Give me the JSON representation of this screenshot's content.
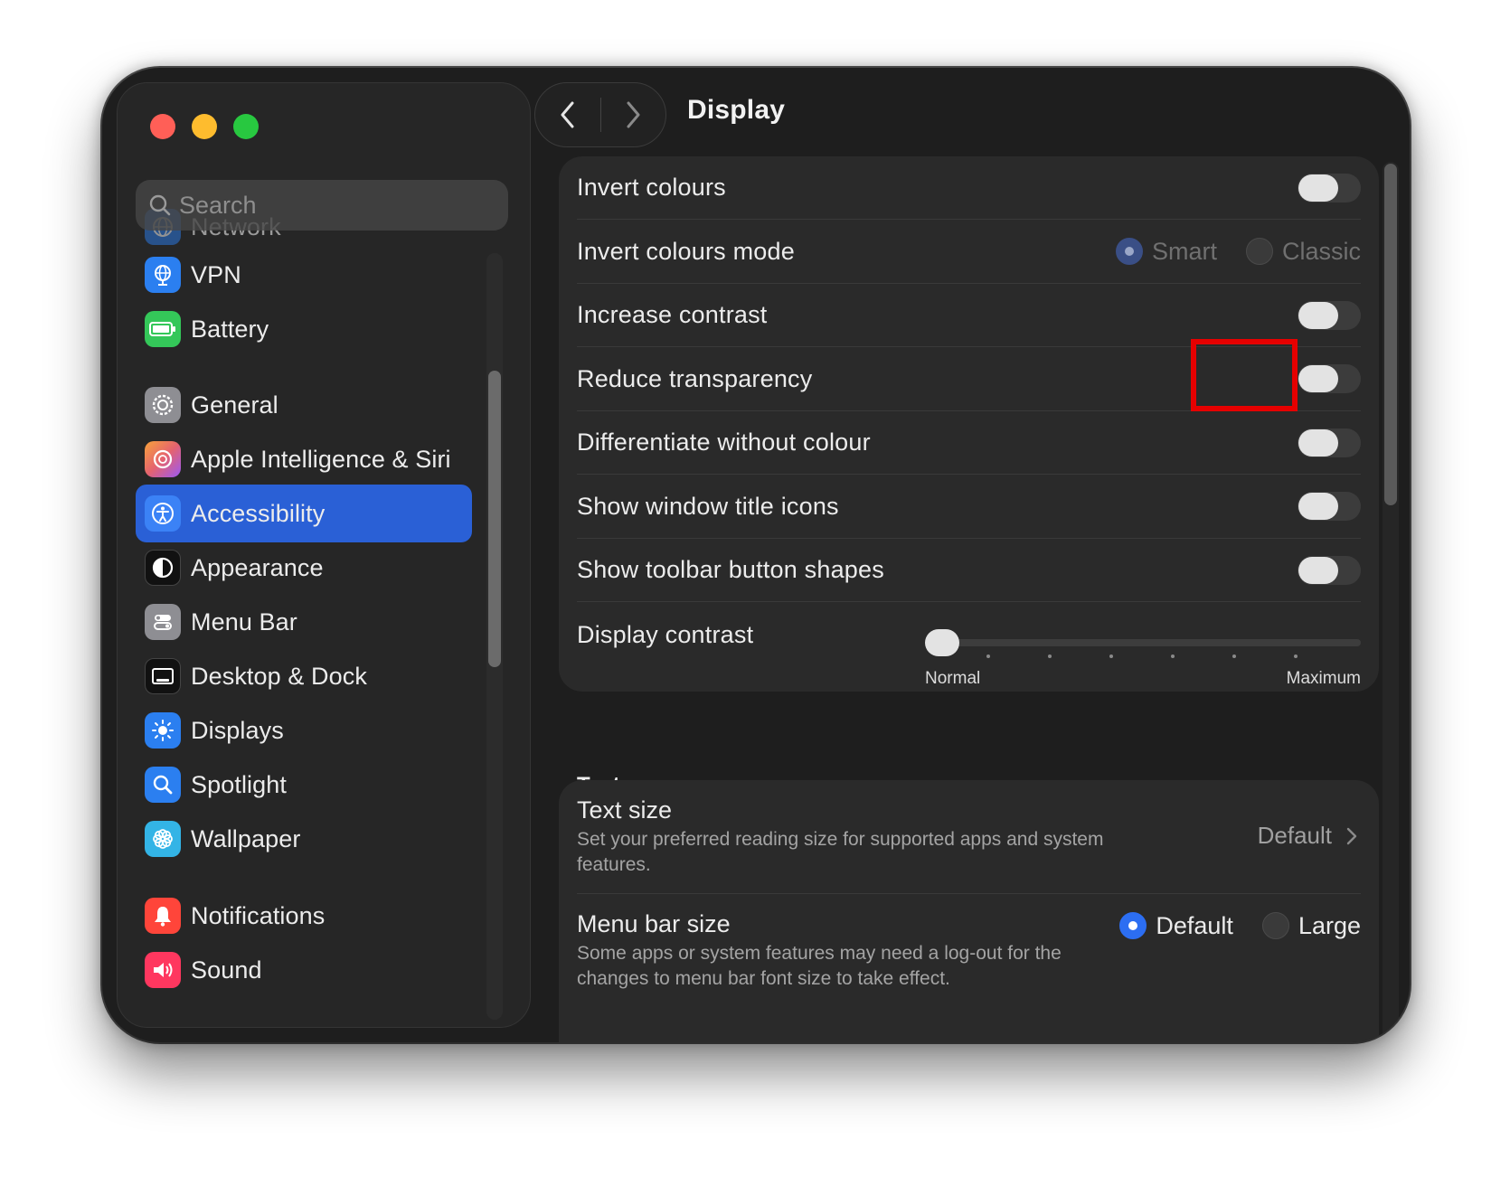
{
  "window": {
    "title": "Display"
  },
  "sidebar": {
    "search_placeholder": "Search",
    "items": [
      {
        "label": "Network",
        "icon": "globe-icon",
        "color": "#2b7ff0"
      },
      {
        "label": "VPN",
        "icon": "vpn-globe-icon",
        "color": "#2b7ff0"
      },
      {
        "label": "Battery",
        "icon": "battery-icon",
        "color": "#34c759"
      },
      {
        "label": "General",
        "icon": "gear-icon",
        "color": "#8e8e93"
      },
      {
        "label": "Apple Intelligence & Siri",
        "icon": "siri-icon",
        "color": "#e5636f"
      },
      {
        "label": "Accessibility",
        "icon": "accessibility-icon",
        "color": "#2b7ff0",
        "selected": true
      },
      {
        "label": "Appearance",
        "icon": "appearance-icon",
        "color": "#000000"
      },
      {
        "label": "Menu Bar",
        "icon": "menu-bar-icon",
        "color": "#8e8e93"
      },
      {
        "label": "Desktop & Dock",
        "icon": "desktop-dock-icon",
        "color": "#000000"
      },
      {
        "label": "Displays",
        "icon": "sun-icon",
        "color": "#2b7ff0"
      },
      {
        "label": "Spotlight",
        "icon": "magnifier-icon",
        "color": "#2b7ff0"
      },
      {
        "label": "Wallpaper",
        "icon": "flower-icon",
        "color": "#33b4e6"
      },
      {
        "label": "Notifications",
        "icon": "bell-icon",
        "color": "#ff453a"
      },
      {
        "label": "Sound",
        "icon": "speaker-icon",
        "color": "#ff375f"
      }
    ]
  },
  "nav": {
    "back": "back-chevron-icon",
    "forward": "forward-chevron-icon"
  },
  "display_panel": {
    "rows": [
      {
        "label": "Invert colours",
        "type": "toggle",
        "on": false
      },
      {
        "label": "Invert colours mode",
        "type": "radio",
        "options": [
          "Smart",
          "Classic"
        ],
        "selected": "Smart",
        "disabled": true
      },
      {
        "label": "Increase contrast",
        "type": "toggle",
        "on": false
      },
      {
        "label": "Reduce transparency",
        "type": "toggle",
        "on": false,
        "highlighted": true
      },
      {
        "label": "Differentiate without colour",
        "type": "toggle",
        "on": false
      },
      {
        "label": "Show window title icons",
        "type": "toggle",
        "on": false
      },
      {
        "label": "Show toolbar button shapes",
        "type": "toggle",
        "on": false
      }
    ],
    "contrast": {
      "label": "Display contrast",
      "min_label": "Normal",
      "max_label": "Maximum",
      "value": 0
    }
  },
  "text_section": {
    "title": "Text",
    "text_size": {
      "title": "Text size",
      "description": "Set your preferred reading size for supported apps and system features.",
      "value": "Default"
    },
    "menu_bar_size": {
      "title": "Menu bar size",
      "description": "Some apps or system features may need a log-out for the changes to menu bar font size to take effect.",
      "options": [
        "Default",
        "Large"
      ],
      "selected": "Default"
    }
  },
  "colors": {
    "accent": "#2a60d6",
    "highlight": "#e60000",
    "window_bg": "#1e1e1e"
  }
}
